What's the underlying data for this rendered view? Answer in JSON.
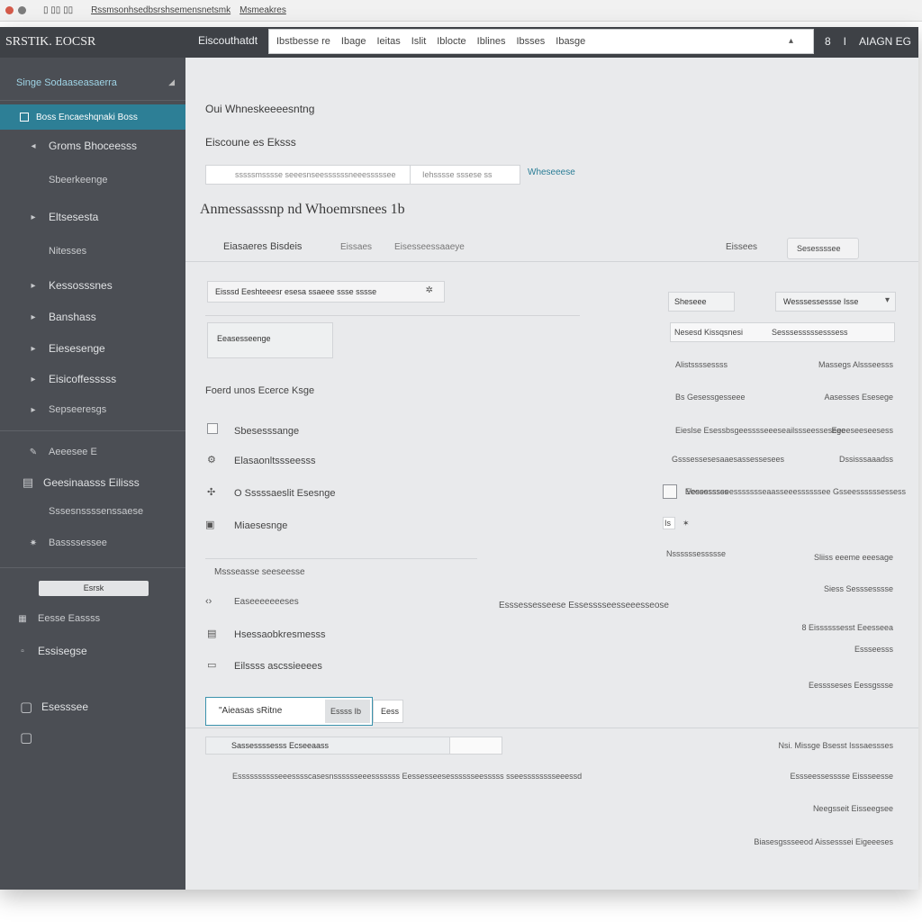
{
  "browser": {
    "tab_text": "Rssmsonhsedbsrshsemensnetsmk",
    "tab_text2": "Msmeakres",
    "dot_colors": [
      "#d45a4a",
      "#7c7c7c"
    ]
  },
  "topbar": {
    "title": "Eiscouthatdt",
    "address_items": [
      "Ibstbesse re",
      "Ibage",
      "Ieitas",
      "Islit",
      "Iblocte",
      "Iblines",
      "Ibsses",
      "Ibasge"
    ],
    "right_items": [
      "8",
      "I",
      "AIAGN EG"
    ]
  },
  "sidebar": {
    "brand": "SRSTIK. EOCSR",
    "dropdown_label": "Singe Sodaaseasaerra",
    "active_item": "Boss Encaeshqnaki Boss",
    "items": [
      {
        "label": "Groms Bhoceesss",
        "icon": "chevron-right-icon"
      },
      {
        "label": "Sbeerkeenge",
        "icon": ""
      },
      {
        "label": "Eltsesesta",
        "icon": "chevron-right-icon"
      },
      {
        "label": "Nitesses",
        "icon": ""
      },
      {
        "label": "Kessosssnes",
        "icon": "chevron-right-icon"
      },
      {
        "label": "Banshass",
        "icon": "chevron-right-icon"
      },
      {
        "label": "Eiesesenge",
        "icon": "chevron-right-icon"
      },
      {
        "label": "Eisicoffesssss",
        "icon": "chevron-right-icon"
      },
      {
        "label": "Sepseeresgs",
        "icon": "chevron-right-icon"
      },
      {
        "label": "Aeeesee E",
        "icon": "pencil-icon"
      },
      {
        "label": "Geesinaasss Eilisss",
        "icon": "calendar-icon"
      },
      {
        "label": "Sssesnssssenssaese",
        "icon": ""
      },
      {
        "label": "Bassssessee",
        "icon": "star-icon"
      }
    ],
    "button_label": "Esrsk",
    "bottom_items": [
      {
        "label": "Eesse Eassss",
        "icon": "grid-icon"
      },
      {
        "label": "Essisegse",
        "icon": "square-icon"
      },
      {
        "label": "Esesssee",
        "icon": "folder-icon"
      },
      {
        "label": "",
        "icon": "document-icon"
      }
    ]
  },
  "main": {
    "heading": "Oui Whneskeeeesntng",
    "subheading": "Eiscoune es Eksss",
    "search_placeholder": "sssssmsssse seeesnseessssssneeesssssee",
    "search_suffix": "Iehsssse sssese ss",
    "search_link": "Wheseeese",
    "section_title": "Anmessasssnp nd Whoemrsnees 1b",
    "tabs": [
      "Eiasaeres Bisdeis",
      "Eissaes",
      "Eisesseessaaeye"
    ],
    "tab_right_label": "Eissees",
    "tab_right_button": "Sesessssee",
    "filter_box": "Eisssd Eeshteeesr esesa ssaeee ssse sssse",
    "filter_button": "Eeasesseenge",
    "list_title": "Foerd unos Ecerce Ksge",
    "list_items": [
      {
        "label": "Sbesesssange",
        "icon": "checkbox-icon"
      },
      {
        "label": "Elasaonltssseesss",
        "icon": "gear-icon"
      },
      {
        "label": "O Sssssaeslit Esesnge",
        "icon": "settings-icon"
      },
      {
        "label": "Miaesesnge",
        "icon": "image-icon"
      }
    ],
    "group_title": "Mssseasse seeseesse",
    "group_items": [
      {
        "label": "Easeeeeeeeses",
        "icon": "code-icon"
      },
      {
        "label": "Hsessaobkresmesss",
        "icon": "calendar-icon"
      },
      {
        "label": "Eilssss ascssieeees",
        "icon": "document-icon"
      }
    ],
    "center_note": "Esssessesseese Essesssseesseeesseose",
    "input_value": "\"Aieasas sRitne",
    "input_button": "Essss Ib",
    "small_button": "Eess",
    "footer_field_label": "Sassessssesss Ecseeaass",
    "footer_note": "Esssssssssseeesssscasesnsssssseeesssssss Eessesseesesssssseesssss sseesssssssseeessd",
    "right_panel": {
      "select1": "Sheseee",
      "select2": "Wesssessessse Isse",
      "row_header_left": "Nesesd Kissqsnesi",
      "row_header_right": "Sesssesssssesssess",
      "rows": [
        {
          "left": "Alistssssessss",
          "right": "Massegs Alssseesss"
        },
        {
          "left": "Bs Gesessgesseee",
          "right": "Aasesses Esesege"
        },
        {
          "left": "Eieslse Esessbsgeesssseeeseailssseessesege",
          "right": "Eeeeseeseesess"
        },
        {
          "left": "Gsssessesesaaesassessesees",
          "right": "Dssisssaaadss"
        },
        {
          "left": "Vesessssss",
          "right": "Eeesessseeessssssseaasseeessssssee Gsseessssssessess"
        }
      ],
      "small_row": "Is",
      "misc_label": "Nssssssessssse",
      "right_texts": [
        "Sliiss eeeme eeesage",
        "Siess Sesssesssse",
        "8 Eissssssesst Eeesseea",
        "Essseesss",
        "Eesssseses Eessgssse",
        "Nsi. Missge Bsesst Isssaessses",
        "Essseessesssse Eissseesse",
        "Neegsseit Eisseegsee",
        "Biasesgssseeod Aissesssei Eigeeeses"
      ]
    }
  }
}
